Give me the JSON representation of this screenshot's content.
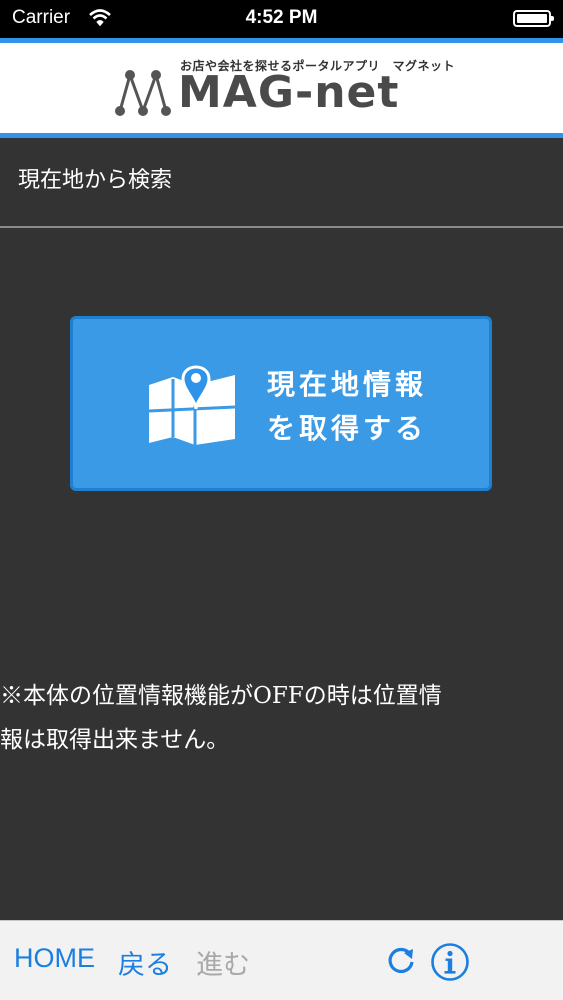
{
  "status_bar": {
    "carrier": "Carrier",
    "time": "4:52 PM"
  },
  "header": {
    "tagline": "お店や会社を探せるポータルアプリ　マグネット",
    "logo_text": "MAG-net"
  },
  "section": {
    "title": "現在地から検索"
  },
  "location_button": {
    "line1": "現在地情報",
    "line2": "を取得する"
  },
  "notice": {
    "line1": "※本体の位置情報機能がOFFの時は位置情",
    "line2": "報は取得出来ません。"
  },
  "toolbar": {
    "home_label": "HOME",
    "back_label": "戻る",
    "forward_label": "進む"
  },
  "colors": {
    "accent": "#2f94e8",
    "button": "#3a9ae6",
    "background": "#333333",
    "toolbar_link": "#1a7fe0",
    "disabled": "#a9a9a9"
  },
  "icons": [
    "wifi-icon",
    "battery-icon",
    "logo-mark-icon",
    "map-pin-icon",
    "reload-icon",
    "info-icon"
  ]
}
